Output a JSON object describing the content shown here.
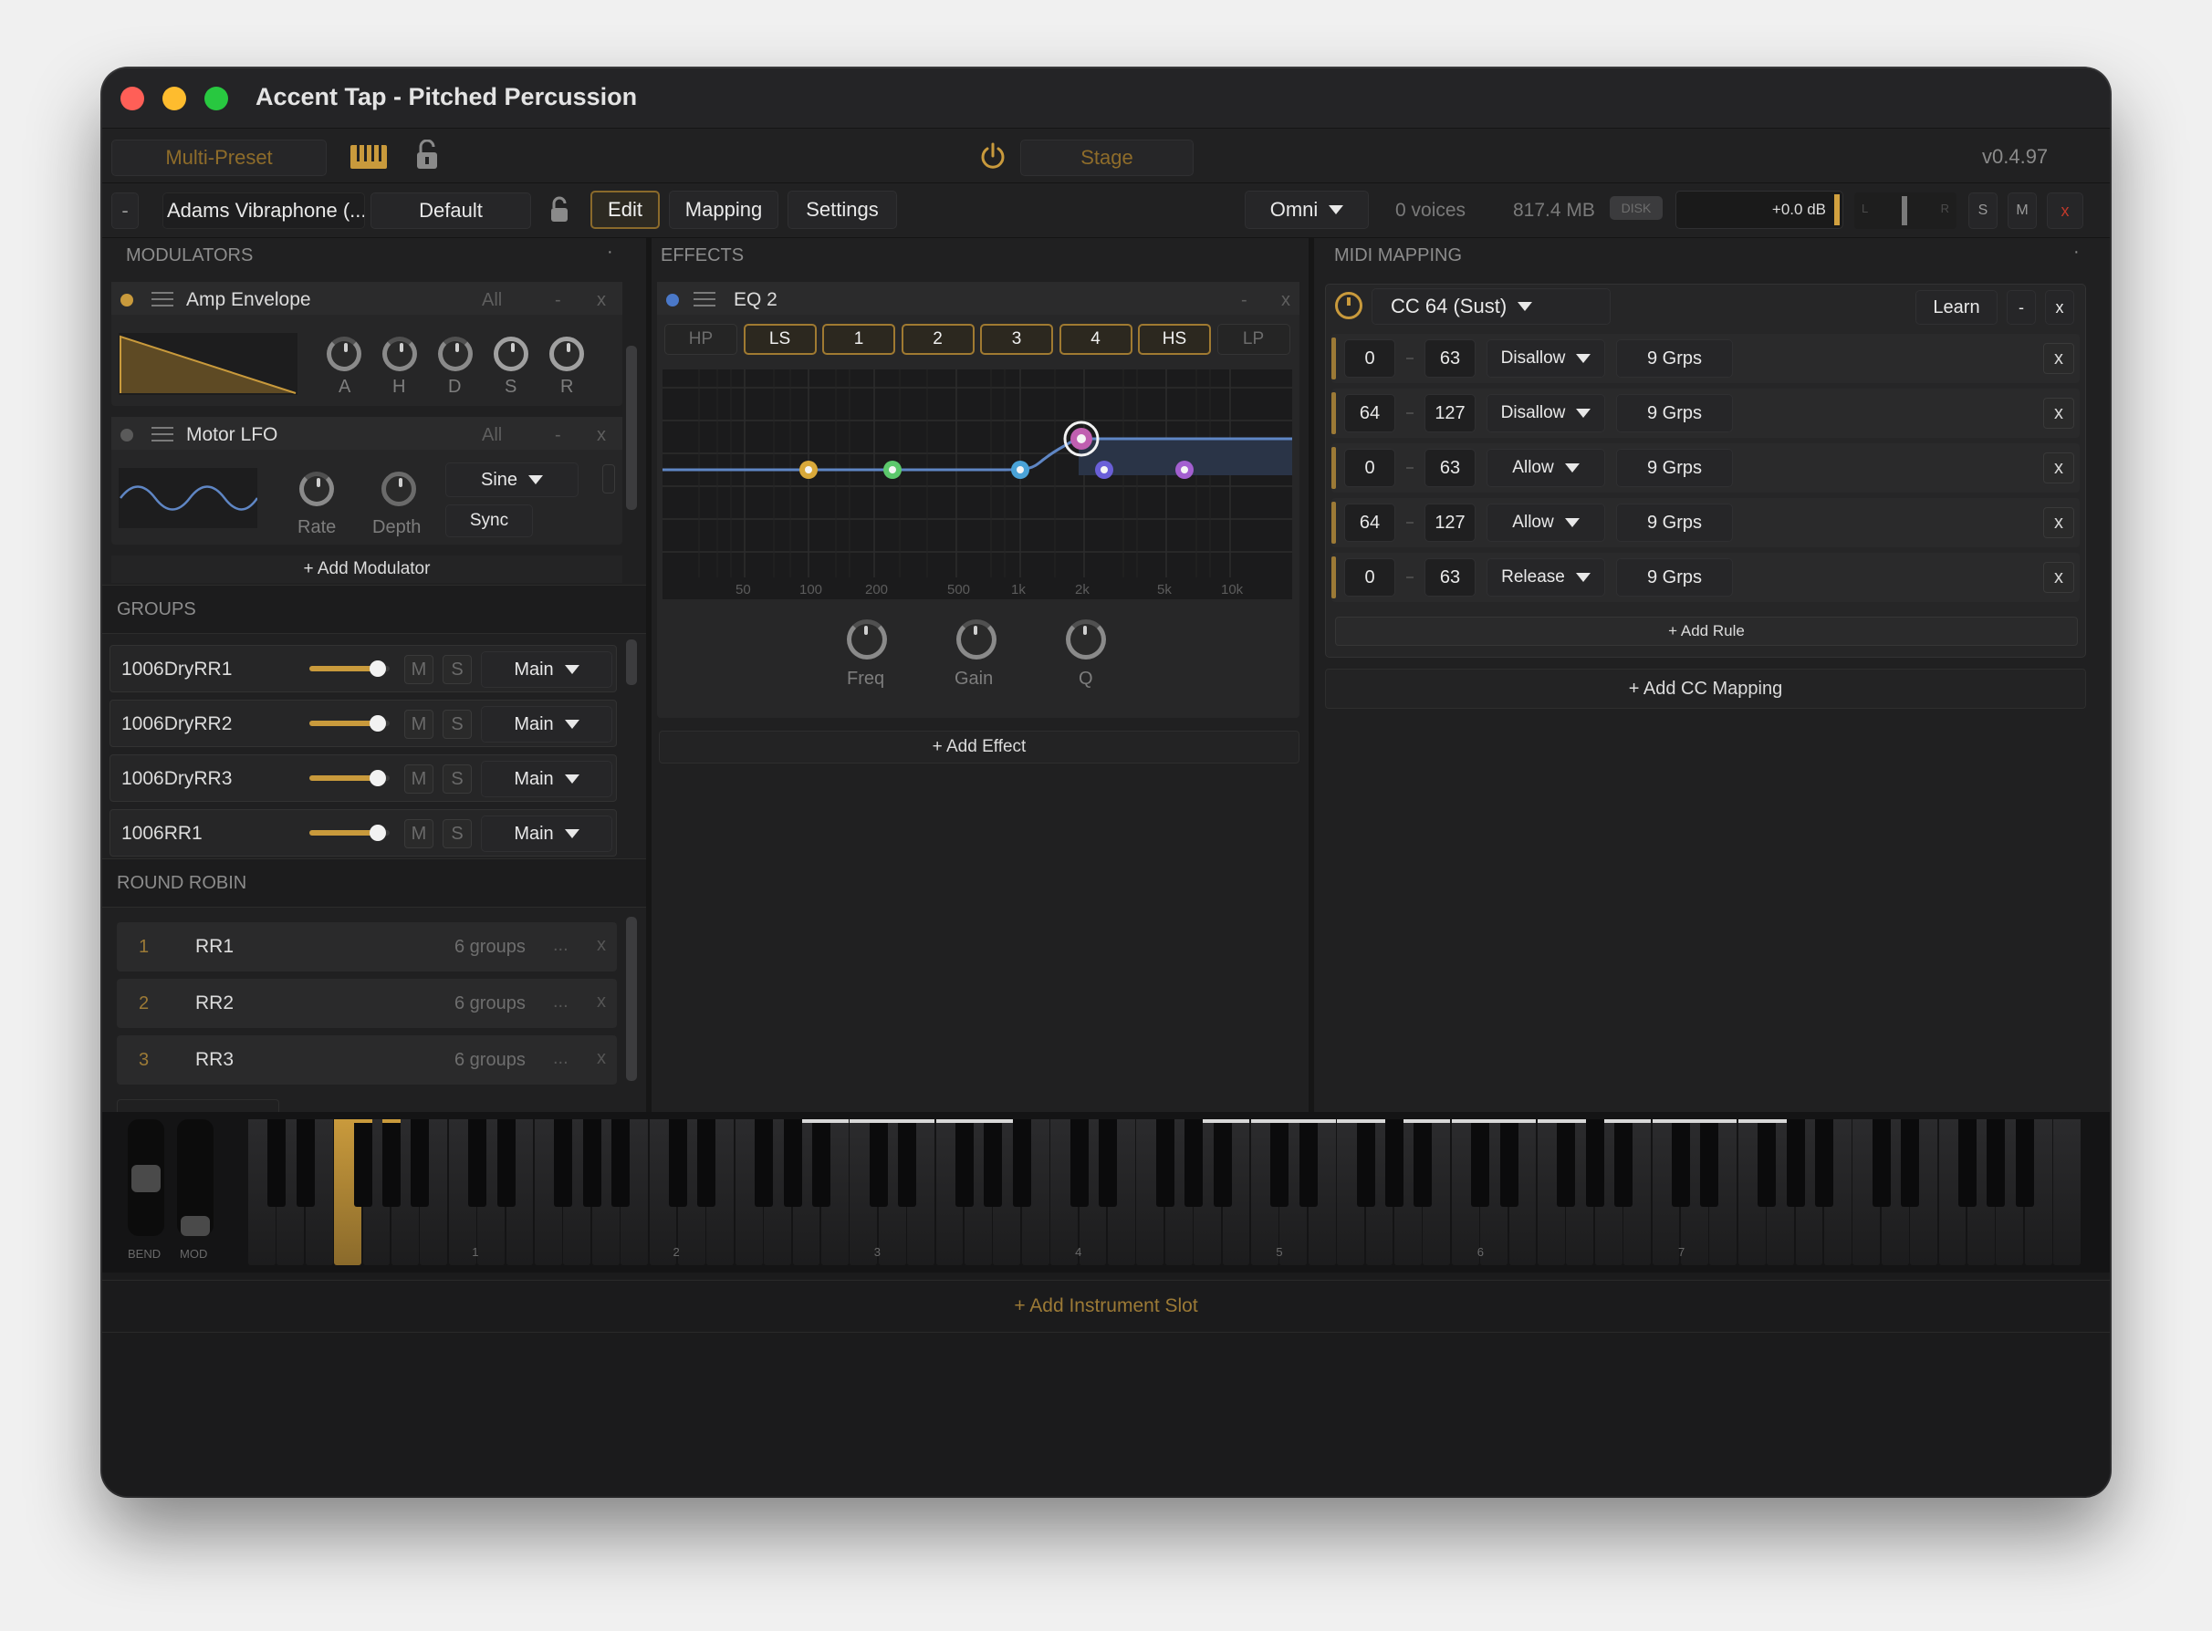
{
  "window": {
    "title": "Accent Tap - Pitched Percussion"
  },
  "toolbar": {
    "multi_preset": "Multi-Preset",
    "stage": "Stage",
    "version": "v0.4.97"
  },
  "slot": {
    "minus": "-",
    "instrument": "Adams Vibraphone (...",
    "preset": "Default",
    "tabs": [
      "Edit",
      "Mapping",
      "Settings"
    ],
    "midi_channel": "Omni",
    "voices": "0 voices",
    "memory": "817.4 MB",
    "disk": "DISK",
    "volume": "+0.0 dB",
    "meter_l": "L",
    "meter_r": "R",
    "solo": "S",
    "mute": "M",
    "close": "x"
  },
  "modulators": {
    "title": "MODULATORS",
    "dot": "·",
    "amp": {
      "name": "Amp Envelope",
      "target": "All",
      "minus": "-",
      "close": "x",
      "knobs": [
        "A",
        "H",
        "D",
        "S",
        "R"
      ]
    },
    "lfo": {
      "name": "Motor LFO",
      "target": "All",
      "minus": "-",
      "close": "x",
      "rate": "Rate",
      "depth": "Depth",
      "shape": "Sine",
      "sync": "Sync"
    },
    "add": "+ Add Modulator"
  },
  "groups": {
    "title": "GROUPS",
    "items": [
      {
        "name": "1006DryRR1",
        "m": "M",
        "s": "S",
        "out": "Main",
        "level": 0.85
      },
      {
        "name": "1006DryRR2",
        "m": "M",
        "s": "S",
        "out": "Main",
        "level": 0.85
      },
      {
        "name": "1006DryRR3",
        "m": "M",
        "s": "S",
        "out": "Main",
        "level": 0.85
      },
      {
        "name": "1006RR1",
        "m": "M",
        "s": "S",
        "out": "Main",
        "level": 0.85
      }
    ]
  },
  "round_robin": {
    "title": "ROUND ROBIN",
    "items": [
      {
        "num": "1",
        "name": "RR1",
        "count": "6 groups",
        "more": "...",
        "close": "x"
      },
      {
        "num": "2",
        "name": "RR2",
        "count": "6 groups",
        "more": "...",
        "close": "x"
      },
      {
        "num": "3",
        "name": "RR3",
        "count": "6 groups",
        "more": "...",
        "close": "x"
      }
    ]
  },
  "effects": {
    "title": "EFFECTS",
    "dot": "·",
    "eq": {
      "name": "EQ 2",
      "minus": "-",
      "close": "x",
      "bands": [
        {
          "label": "HP",
          "on": false
        },
        {
          "label": "LS",
          "on": true
        },
        {
          "label": "1",
          "on": true
        },
        {
          "label": "2",
          "on": true
        },
        {
          "label": "3",
          "on": true
        },
        {
          "label": "4",
          "on": true
        },
        {
          "label": "HS",
          "on": true
        },
        {
          "label": "LP",
          "on": false
        }
      ],
      "freq_labels": [
        "50",
        "100",
        "200",
        "500",
        "1k",
        "2k",
        "5k",
        "10k"
      ],
      "knobs": [
        "Freq",
        "Gain",
        "Q"
      ],
      "colors": {
        "ls": "#d9a93a",
        "b1": "#5cc86c",
        "b2": "#4aa3d8",
        "b3": "#6a5fd8",
        "b4": "#a35fd0",
        "hs": "#c05fb0",
        "curve": "#5f86c4"
      }
    },
    "add": "+ Add Effect"
  },
  "midi": {
    "title": "MIDI MAPPING",
    "dot": "·",
    "cc": "CC 64 (Sust)",
    "learn": "Learn",
    "minus": "-",
    "close": "x",
    "rules": [
      {
        "lo": "0",
        "hi": "63",
        "action": "Disallow",
        "groups": "9 Grps",
        "close": "x"
      },
      {
        "lo": "64",
        "hi": "127",
        "action": "Disallow",
        "groups": "9 Grps",
        "close": "x"
      },
      {
        "lo": "0",
        "hi": "63",
        "action": "Allow",
        "groups": "9 Grps",
        "close": "x"
      },
      {
        "lo": "64",
        "hi": "127",
        "action": "Allow",
        "groups": "9 Grps",
        "close": "x"
      },
      {
        "lo": "0",
        "hi": "63",
        "action": "Release",
        "groups": "9 Grps",
        "close": "x"
      }
    ],
    "add_rule": "+ Add Rule",
    "add_cc": "+ Add CC Mapping"
  },
  "keyboard": {
    "bend": "BEND",
    "mod": "MOD",
    "octaves": [
      "1",
      "2",
      "3",
      "4",
      "5",
      "6",
      "7"
    ]
  },
  "footer": {
    "add_slot": "+ Add Instrument Slot"
  }
}
